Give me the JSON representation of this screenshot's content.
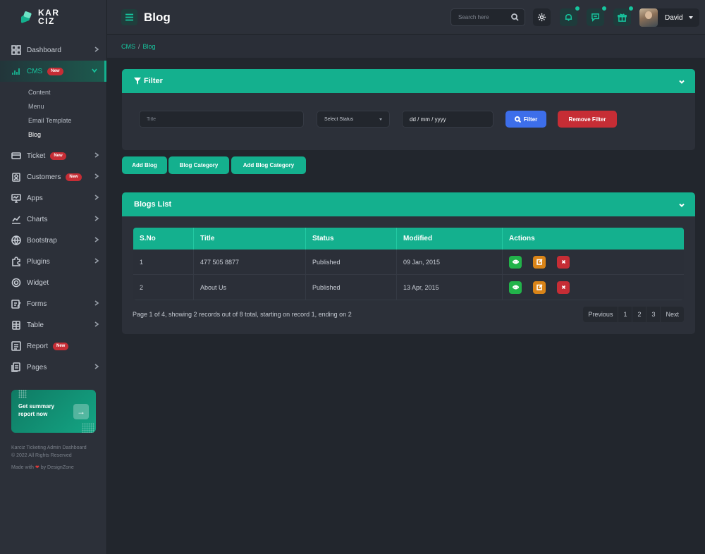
{
  "brand": {
    "line1": "KAR",
    "line2": "CIZ"
  },
  "sidebar": {
    "items": [
      {
        "label": "Dashboard",
        "badge": ""
      },
      {
        "label": "CMS",
        "badge": "New"
      },
      {
        "label": "Ticket",
        "badge": "New"
      },
      {
        "label": "Customers",
        "badge": "New"
      },
      {
        "label": "Apps",
        "badge": ""
      },
      {
        "label": "Charts",
        "badge": ""
      },
      {
        "label": "Bootstrap",
        "badge": ""
      },
      {
        "label": "Plugins",
        "badge": ""
      },
      {
        "label": "Widget",
        "badge": ""
      },
      {
        "label": "Forms",
        "badge": ""
      },
      {
        "label": "Table",
        "badge": ""
      },
      {
        "label": "Report",
        "badge": "New"
      },
      {
        "label": "Pages",
        "badge": ""
      }
    ],
    "cms_sub": [
      "Content",
      "Menu",
      "Email Template",
      "Blog"
    ],
    "promo": {
      "text": "Get summary report now",
      "arrow": "→"
    },
    "footer": {
      "line1": "Karciz Ticketing Admin Dashboard",
      "line2": "© 2022 All Rights Reserved",
      "made_pre": "Made with",
      "heart": "❤",
      "made_post": "by DesignZone"
    }
  },
  "header": {
    "title": "Blog",
    "search_placeholder": "Search here",
    "user_name": "David"
  },
  "breadcrumb": {
    "root": "CMS",
    "sep": "/",
    "current": "Blog"
  },
  "filter": {
    "title": "Filter",
    "title_placeholder": "Title",
    "status_value": "Select Status",
    "date_value": "dd / mm / yyyy",
    "filter_button": "Filter",
    "remove_button": "Remove Filter"
  },
  "actions": {
    "add_blog": "Add Blog",
    "blog_category": "Blog Category",
    "add_blog_category": "Add Blog Category"
  },
  "blogs": {
    "title": "Blogs List",
    "columns": [
      "S.No",
      "Title",
      "Status",
      "Modified",
      "Actions"
    ],
    "rows": [
      {
        "sno": "1",
        "title": "477 505 8877",
        "status": "Published",
        "modified": "09 Jan, 2015"
      },
      {
        "sno": "2",
        "title": "About Us",
        "status": "Published",
        "modified": "13 Apr, 2015"
      }
    ],
    "pager_info": "Page 1 of 4, showing 2 records out of 8 total, starting on record 1, ending on 2",
    "pager": {
      "previous": "Previous",
      "pages": [
        "1",
        "2",
        "3"
      ],
      "next": "Next"
    }
  },
  "colors": {
    "accent": "#14b08e",
    "primary": "#3d6eea",
    "danger": "#c62d35",
    "warning": "#d98418",
    "success": "#22b34a"
  }
}
